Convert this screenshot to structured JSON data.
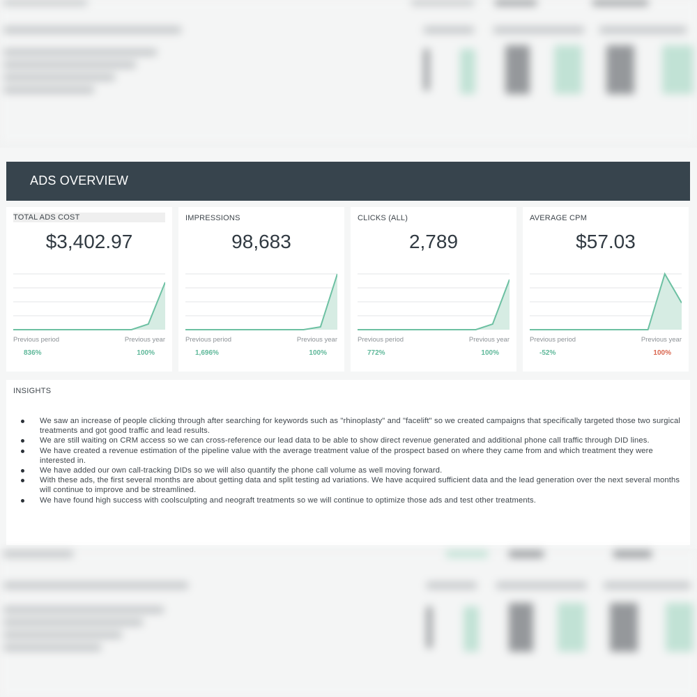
{
  "dashboard": {
    "section_title": "ADS OVERVIEW",
    "colors": {
      "header_bg": "#37444d",
      "positive": "#5fb89a",
      "negative": "#d9664f",
      "spark_fill": "#d6ece3",
      "spark_line": "#6cc0a2"
    },
    "cards": [
      {
        "label": "TOTAL  ADS COST",
        "value": "$3,402.97",
        "prev_period_label": "Previous period",
        "prev_year_label": "Previous year",
        "prev_period_value": "836%",
        "prev_year_value": "100%",
        "prev_year_status": "positive",
        "trend": [
          0,
          0,
          0,
          0,
          0,
          0,
          0,
          0,
          0.1,
          0.85
        ]
      },
      {
        "label": "IMPRESSIONS",
        "value": "98,683",
        "prev_period_label": "Previous period",
        "prev_year_label": "Previous year",
        "prev_period_value": "1,696%",
        "prev_year_value": "100%",
        "prev_year_status": "positive",
        "trend": [
          0,
          0,
          0,
          0,
          0,
          0,
          0,
          0,
          0.05,
          1.0
        ]
      },
      {
        "label": "CLICKS (ALL)",
        "value": "2,789",
        "prev_period_label": "Previous period",
        "prev_year_label": "Previous year",
        "prev_period_value": "772%",
        "prev_year_value": "100%",
        "prev_year_status": "positive",
        "trend": [
          0,
          0,
          0,
          0,
          0,
          0,
          0,
          0,
          0.1,
          0.9
        ]
      },
      {
        "label": "AVERAGE CPM",
        "value": "$57.03",
        "prev_period_label": "Previous period",
        "prev_year_label": "Previous year",
        "prev_period_value": "-52%",
        "prev_year_value": "100%",
        "prev_year_status": "negative",
        "trend": [
          0,
          0,
          0,
          0,
          0,
          0,
          0,
          0,
          1.0,
          0.48
        ]
      }
    ],
    "insights": {
      "title": "INSIGHTS",
      "items": [
        "We saw an increase of people clicking through after searching for keywords such as \"rhinoplasty\" and \"facelift\" so we created campaigns that specifically targeted those two surgical treatments and got good traffic and lead results.",
        "We are still waiting on CRM access so we can cross-reference our lead data to be able to show direct revenue generated and additional phone call traffic through DID lines.",
        "We have created a revenue estimation of the pipeline value with the average treatment value of the prospect based on where they came from and which treatment they were interested in.",
        "We have added our own call-tracking DIDs so we will also quantify the phone call volume as well moving forward.",
        "With these ads, the first several months are about getting data and split testing ad variations. We have acquired sufficient data and the lead generation over the next several months will continue to improve and be streamlined.",
        "We have found high success with coolsculpting and neograft treatments so we will continue to optimize those ads and test other treatments."
      ]
    }
  }
}
